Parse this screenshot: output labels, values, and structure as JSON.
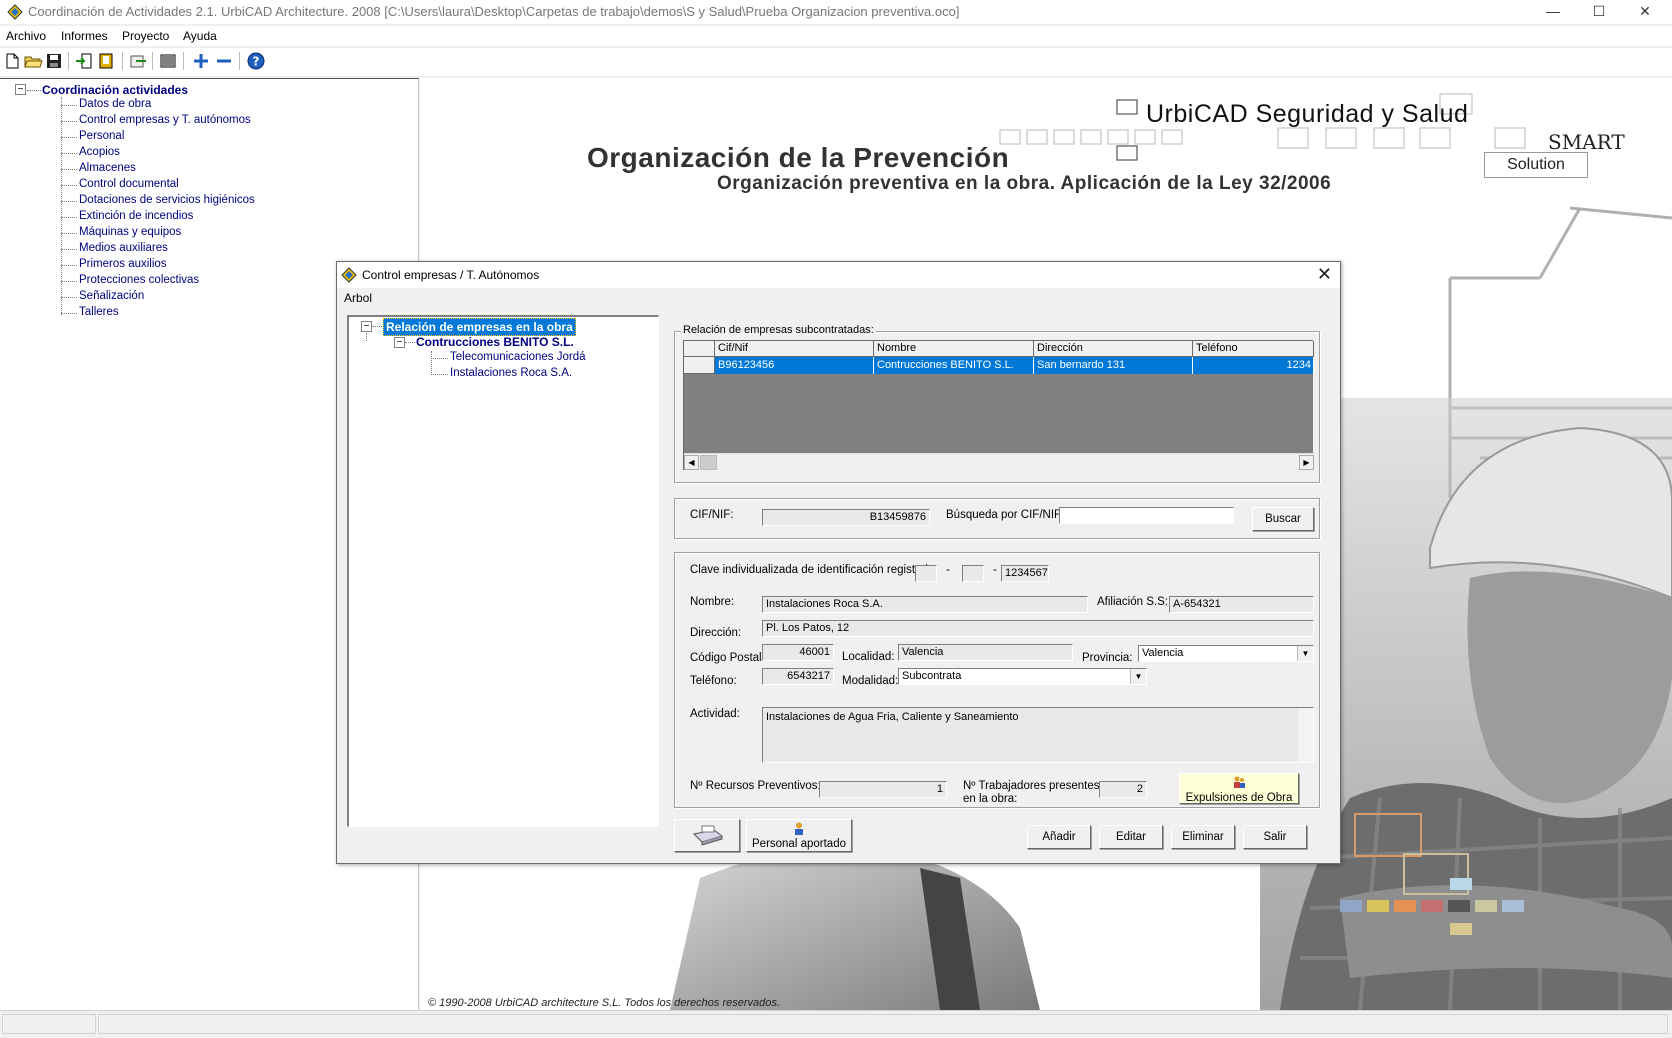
{
  "window": {
    "title": "Coordinación de Actividades 2.1. UrbiCAD Architecture. 2008 [C:\\Users\\laura\\Desktop\\Carpetas de trabajo\\demos\\S y Salud\\Prueba Organizacion preventiva.oco]",
    "minimize": "—",
    "maximize": "☐",
    "close": "✕"
  },
  "menu": [
    "Archivo",
    "Informes",
    "Proyecto",
    "Ayuda"
  ],
  "tree": {
    "root": "Coordinación actividades",
    "items": [
      "Datos de obra",
      "Control empresas y T. autónomos",
      "Personal",
      "Acopios",
      "Almacenes",
      "Control documental",
      "Dotaciones de servicios higiénicos",
      "Extinción de incendios",
      "Máquinas y equipos",
      "Medios auxiliares",
      "Primeros auxilios",
      "Protecciones colectivas",
      "Señalización",
      "Talleres"
    ]
  },
  "background": {
    "brand_line1": "UrbiCAD Seguridad y Salud",
    "brand_smart": "SMART",
    "brand_solution": "Solution",
    "heading": "Organización de la Prevención",
    "subheading": "Organización preventiva en la obra. Aplicación de la Ley 32/2006",
    "copyright": "© 1990-2008 UrbiCAD architecture S.L. Todos los derechos reservados."
  },
  "dialog": {
    "title": "Control empresas / T. Autónomos",
    "close": "✕",
    "menu_label": "Arbol",
    "tree": {
      "root": "Relación de empresas en la obra",
      "company": "Contrucciones BENITO S.L.",
      "subs": [
        "Telecomunicaciones Jordá",
        "Instalaciones Roca S.A."
      ]
    },
    "grid": {
      "group_label": "Relación de empresas subcontratadas:",
      "columns": [
        "Cif/Nif",
        "Nombre",
        "Dirección",
        "Teléfono"
      ],
      "rows": [
        {
          "cif": "B96123456",
          "nombre": "Contrucciones BENITO S.L.",
          "direccion": "San bernardo 131",
          "telefono": "1234"
        }
      ]
    },
    "search": {
      "cif_label": "CIF/NIF:",
      "cif_value": "B13459876",
      "busqueda_label": "Búsqueda por CIF/NIF",
      "busqueda_value": "",
      "buscar_button": "Buscar"
    },
    "details": {
      "clave_label": "Clave individualizada de identificación registral:",
      "clave_part1": "",
      "clave_part2": "",
      "clave_part3": "1234567",
      "dash": "-",
      "nombre_label": "Nombre:",
      "nombre_value": "Instalaciones Roca S.A.",
      "afiliacion_label": "Afiliación S.S:",
      "afiliacion_value": "A-654321",
      "direccion_label": "Dirección:",
      "direccion_value": "Pl. Los Patos, 12",
      "cp_label": "Código Postal:",
      "cp_value": "46001",
      "localidad_label": "Localidad:",
      "localidad_value": "Valencia",
      "provincia_label": "Provincia:",
      "provincia_value": "Valencia",
      "telefono_label": "Teléfono:",
      "telefono_value": "6543217",
      "modalidad_label": "Modalidad:",
      "modalidad_value": "Subcontrata",
      "actividad_label": "Actividad:",
      "actividad_value": "Instalaciones de Agua Fria, Caliente y Saneamiento",
      "recursos_label": "Nº Recursos Preventivos:",
      "recursos_value": "1",
      "trabajadores_label_1": "Nº Trabajadores presentes",
      "trabajadores_label_2": "en la obra:",
      "trabajadores_value": "2",
      "expulsiones_button": "Expulsiones de Obra"
    },
    "buttons": {
      "personal": "Personal aportado",
      "anadir": "Añadir",
      "editar": "Editar",
      "eliminar": "Eliminar",
      "salir": "Salir"
    }
  }
}
